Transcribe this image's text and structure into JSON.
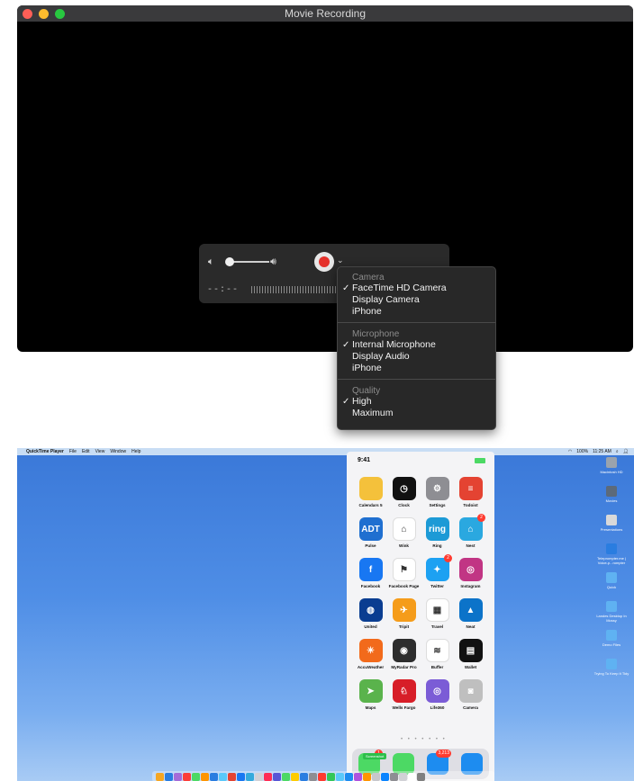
{
  "window": {
    "title": "Movie Recording"
  },
  "controls": {
    "time": "--:--"
  },
  "menu": {
    "camera_heading": "Camera",
    "camera_items": [
      {
        "label": "FaceTime HD Camera",
        "checked": true
      },
      {
        "label": "Display Camera",
        "checked": false
      },
      {
        "label": "iPhone",
        "checked": false
      }
    ],
    "mic_heading": "Microphone",
    "mic_items": [
      {
        "label": "Internal Microphone",
        "checked": true
      },
      {
        "label": "Display Audio",
        "checked": false
      },
      {
        "label": "iPhone",
        "checked": false
      }
    ],
    "quality_heading": "Quality",
    "quality_items": [
      {
        "label": "High",
        "checked": true
      },
      {
        "label": "Maximum",
        "checked": false
      }
    ],
    "check_glyph": "✓"
  },
  "menubar": {
    "apple": "",
    "app": "QuickTime Player",
    "items": [
      "File",
      "Edit",
      "View",
      "Window",
      "Help"
    ],
    "battery": "100%",
    "time": "11:25 AM"
  },
  "desktop_items": [
    {
      "label": "Macintosh HD",
      "color": "#9aa3ad"
    },
    {
      "label": "Movies",
      "color": "#5c6a7a"
    },
    {
      "label": "Presentations",
      "color": "#d9d9d9"
    },
    {
      "label": "Teleprompter.me | Voice-p...rompter",
      "color": "#2a7de0"
    },
    {
      "label": "Quick",
      "color": "#5fb2f2"
    },
    {
      "label": "Landes Desktop In Mossy",
      "color": "#5fb2f2"
    },
    {
      "label": "Demo Files",
      "color": "#5fb2f2"
    },
    {
      "label": "Trying To Keep It Tidy",
      "color": "#5fb2f2"
    }
  ],
  "phone": {
    "time": "9:41",
    "apps": [
      {
        "label": "Calendars 5",
        "color": "#f4c13b",
        "glyph": ""
      },
      {
        "label": "Clock",
        "color": "#111111",
        "glyph": "◷"
      },
      {
        "label": "Settings",
        "color": "#8e8e93",
        "glyph": "⚙"
      },
      {
        "label": "Todoist",
        "color": "#e44332",
        "glyph": "≡"
      },
      {
        "label": "Pulse",
        "color": "#1f6fd0",
        "glyph": "ADT"
      },
      {
        "label": "Wink",
        "color": "#ffffff",
        "glyph": "⌂"
      },
      {
        "label": "Ring",
        "color": "#1c9ad6",
        "glyph": "ring"
      },
      {
        "label": "Nest",
        "color": "#2aa8e0",
        "glyph": "⌂",
        "badge": "2"
      },
      {
        "label": "Facebook",
        "color": "#1877f2",
        "glyph": "f"
      },
      {
        "label": "Facebook Page",
        "color": "#ffffff",
        "glyph": "⚑"
      },
      {
        "label": "Twitter",
        "color": "#1da1f2",
        "glyph": "✦",
        "badge": "2"
      },
      {
        "label": "Instagram",
        "color": "#c13584",
        "glyph": "◎"
      },
      {
        "label": "United",
        "color": "#0a3d91",
        "glyph": "◍"
      },
      {
        "label": "Tripit",
        "color": "#f59c1a",
        "glyph": "✈"
      },
      {
        "label": "Travel",
        "color": "#ffffff",
        "glyph": "▦"
      },
      {
        "label": "Neat",
        "color": "#0c73c9",
        "glyph": "▲"
      },
      {
        "label": "AccuWeather",
        "color": "#f26a1b",
        "glyph": "☀"
      },
      {
        "label": "MyRadar Pro",
        "color": "#2d2d2d",
        "glyph": "◉"
      },
      {
        "label": "Buffer",
        "color": "#ffffff",
        "glyph": "≋"
      },
      {
        "label": "Wallet",
        "color": "#111111",
        "glyph": "▤"
      },
      {
        "label": "Maps",
        "color": "#5ab34c",
        "glyph": "➤"
      },
      {
        "label": "Wells Fargo",
        "color": "#d71e28",
        "glyph": "♘"
      },
      {
        "label": "Life360",
        "color": "#7b5cd6",
        "glyph": "◎"
      },
      {
        "label": "Camera",
        "color": "#bfbfbf",
        "glyph": "◙"
      }
    ],
    "page_dots": "• • • • • • •",
    "dock": [
      {
        "name": "phone",
        "color": "#4cd964",
        "badge": "1"
      },
      {
        "name": "messages",
        "color": "#4cd964",
        "badge": ""
      },
      {
        "name": "mail",
        "color": "#1d8cf0",
        "badge": "3,213"
      },
      {
        "name": "safari",
        "color": "#1d8cf0",
        "badge": ""
      }
    ],
    "screenshot_label": "Screenshot"
  },
  "mac_dock_colors": [
    "#f5a623",
    "#2a7de0",
    "#a56bd8",
    "#fc3d39",
    "#4cd964",
    "#ff9500",
    "#2a7de0",
    "#5ac8fa",
    "#e44332",
    "#1877f2",
    "#34aadc",
    "#d1d1d6",
    "#ff2d55",
    "#5856d6",
    "#4cd964",
    "#ffcc00",
    "#2a7de0",
    "#8e8e93",
    "#ff3b30",
    "#34c759",
    "#5ac8fa",
    "#1d8cf0",
    "#af52de",
    "#ff9500",
    "#c7c7cc",
    "#0a84ff",
    "#8e8e93",
    "#d1d1d6",
    "#ffffff",
    "#7f7f7f"
  ]
}
